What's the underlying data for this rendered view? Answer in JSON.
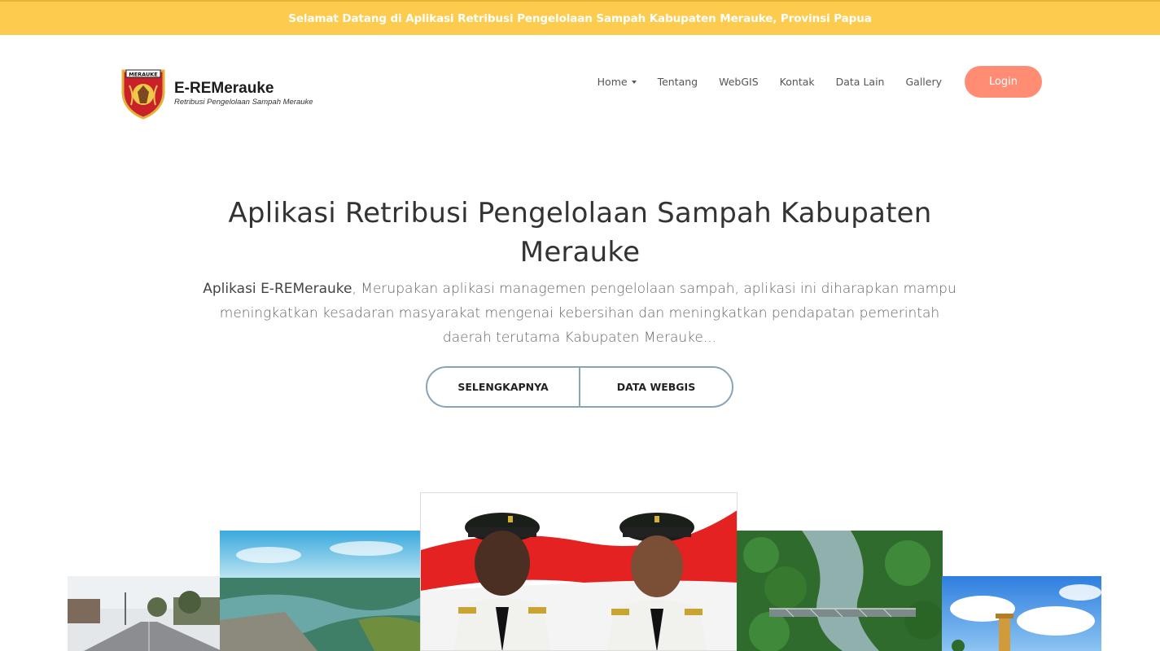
{
  "topbar": {
    "text": "Selamat Datang di Aplikasi Retribusi Pengelolaan Sampah Kabupaten Merauke, Provinsi Papua"
  },
  "brand": {
    "logo_label": "MERAUKE",
    "title": "E-REMerauke",
    "subtitle": "Retribusi Pengelolaan Sampah Merauke"
  },
  "nav": {
    "items": [
      "Home",
      "Tentang",
      "WebGIS",
      "Kontak",
      "Data Lain",
      "Gallery"
    ],
    "login": "Login"
  },
  "hero": {
    "title_line1": "Aplikasi Retribusi Pengelolaan Sampah Kabupaten",
    "title_line2": "Merauke",
    "desc_bold": "Aplikasi E-REMerauke",
    "desc_rest": ", Merupakan aplikasi managemen pengelolaan sampah, aplikasi ini diharapkan mampu meningkatkan kesadaran masyarakat mengenai kebersihan dan meningkatkan pendapatan pemerintah daerah terutama Kabupaten Merauke...",
    "btn_more": "SELENGKAPNYA",
    "btn_webgis": "DATA WEBGIS"
  },
  "colors": {
    "topbar": "#fdcb4e",
    "login": "#ff8c73",
    "button_border": "#8aa3b8"
  }
}
